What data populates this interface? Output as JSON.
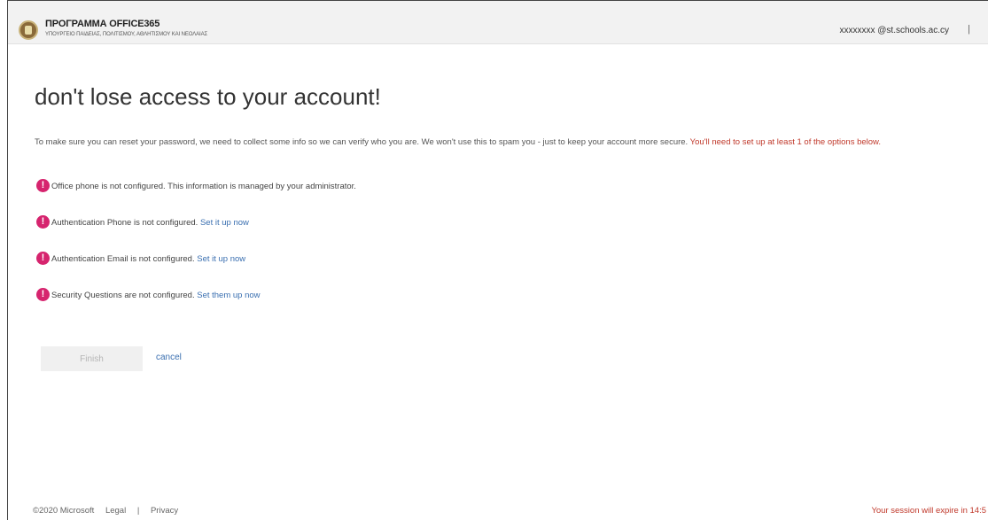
{
  "header": {
    "title": "ΠΡΟΓΡΑΜΜΑ OFFICE365",
    "subtitle": "ΥΠΟΥΡΓΕΙΟ ΠΑΙΔΕΙΑΣ, ΠΟΛΙΤΙΣΜΟΥ, ΑΘΛΗΤΙΣΜΟΥ ΚΑΙ ΝΕΟΛΑΙΑΣ",
    "user": "xxxxxxxx @st.schools.ac.cy",
    "divider": "|"
  },
  "main": {
    "title": "don't lose access to your account!",
    "intro": "To make sure you can reset your password, we need to collect some info so we can verify who you are. We won't use this to spam you - just to keep your account more secure.",
    "intro_red": "You'll need to set up at least 1 of the options below.",
    "items": [
      {
        "icon": "exclamation-circle-icon",
        "text": "Office phone is not configured. This information is managed by your administrator.",
        "link": ""
      },
      {
        "icon": "exclamation-circle-icon",
        "text": "Authentication Phone is not configured.",
        "link": "Set it up now"
      },
      {
        "icon": "exclamation-circle-icon",
        "text": "Authentication Email is not configured.",
        "link": "Set it up now"
      },
      {
        "icon": "exclamation-circle-icon",
        "text": "Security Questions are not configured.",
        "link": "Set them up now"
      }
    ],
    "alert_glyph": "!",
    "finish_label": "Finish",
    "cancel_label": "cancel"
  },
  "footer": {
    "copyright": "©2020 Microsoft",
    "legal": "Legal",
    "sep": "|",
    "privacy": "Privacy",
    "session": "Your session will expire in 14:5"
  },
  "colors": {
    "alert": "#d6246e",
    "link": "#3a6fb0",
    "warning_text": "#c0392b"
  }
}
